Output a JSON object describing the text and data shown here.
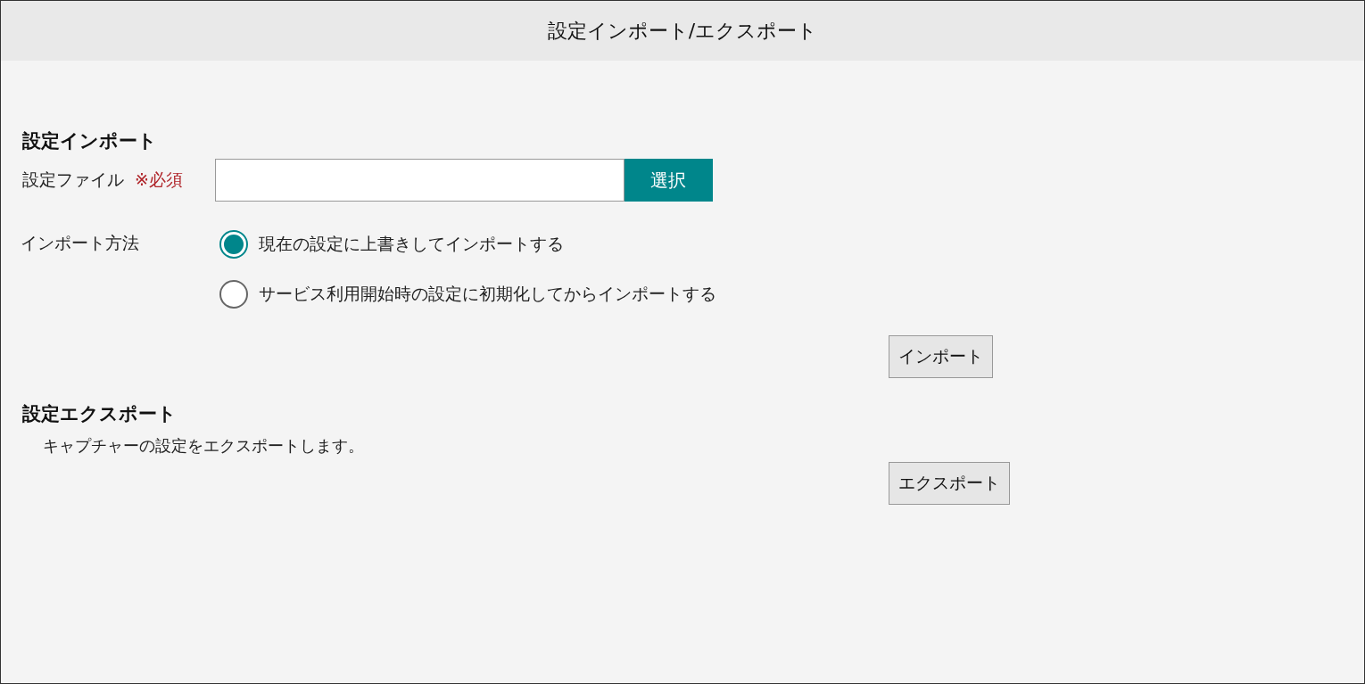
{
  "window": {
    "title": "設定インポート/エクスポート"
  },
  "import_section": {
    "heading": "設定インポート",
    "file_label": "設定ファイル",
    "required_mark": "※必須",
    "select_button": "選択",
    "method_label": "インポート方法",
    "options": [
      {
        "label": "現在の設定に上書きしてインポートする",
        "selected": true
      },
      {
        "label": "サービス利用開始時の設定に初期化してからインポートする",
        "selected": false
      }
    ],
    "button": "インポート"
  },
  "export_section": {
    "heading": "設定エクスポート",
    "description": "キャプチャーの設定をエクスポートします。",
    "button": "エクスポート"
  }
}
